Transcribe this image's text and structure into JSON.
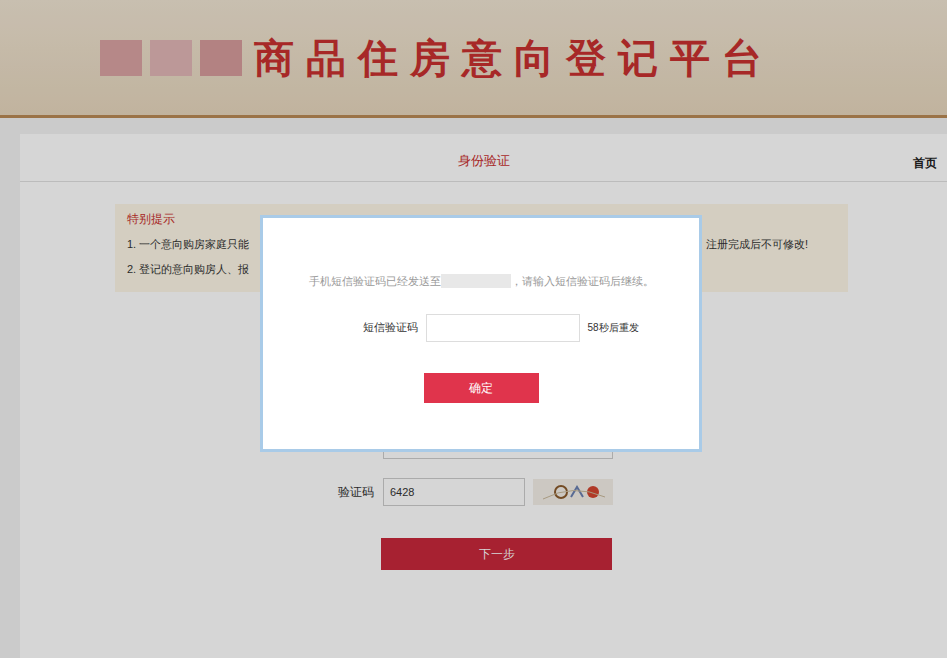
{
  "header": {
    "title": "商品住房意向登记平台"
  },
  "page": {
    "title": "身份验证",
    "nav_link": "首页"
  },
  "notice": {
    "title": "特别提示",
    "lines": [
      {
        "left": "1. 一个意向购房家庭只能",
        "right": "，注册完成后不可修改!"
      },
      {
        "left": "2. 登记的意向购房人、报",
        "right": ""
      }
    ]
  },
  "form": {
    "captcha_label": "验证码",
    "captcha_value": "6428",
    "next_button": "下一步"
  },
  "modal": {
    "message_before": "手机短信验证码已经发送至",
    "message_after": "，请输入短信验证码后继续。",
    "field_label": "短信验证码",
    "field_value": "",
    "resend": "58秒后重发",
    "confirm_button": "确定"
  }
}
